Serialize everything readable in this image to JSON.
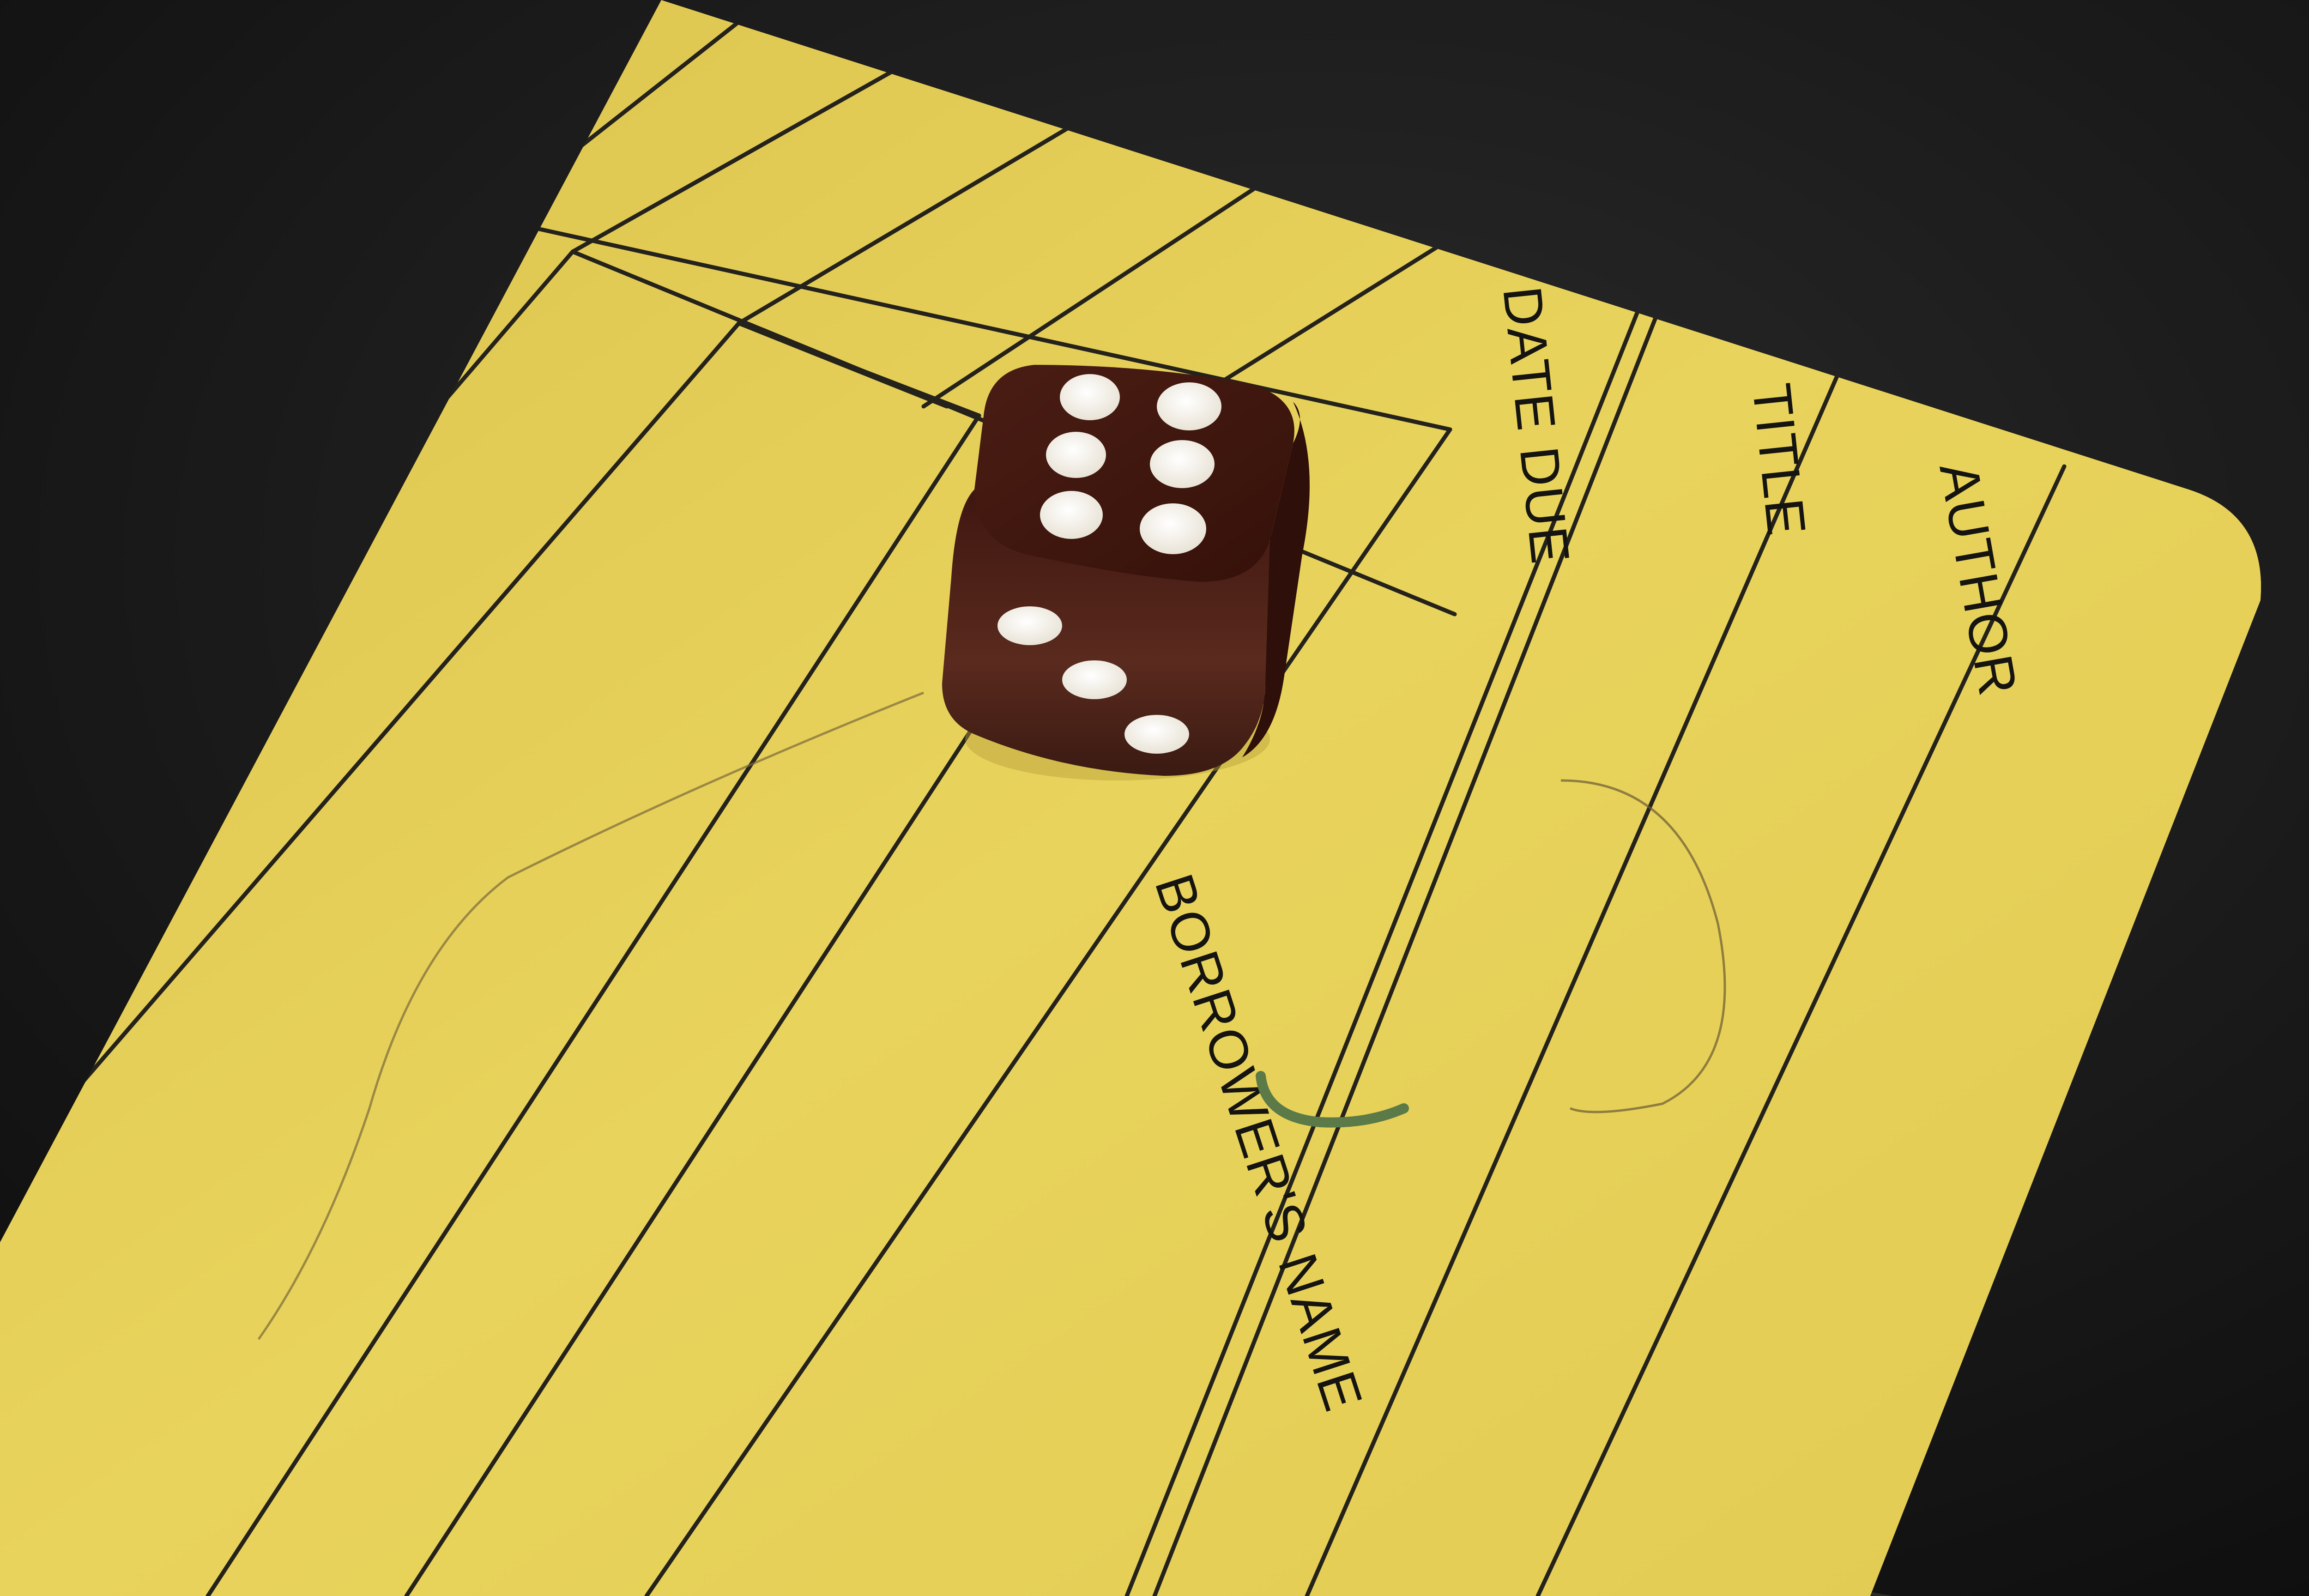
{
  "card": {
    "labels": {
      "author": "AUTHOR",
      "title": "TITLE",
      "date_due": "DATE DUE",
      "borrowers_name": "BORROWER'S NAME"
    }
  },
  "die": {
    "top_face_pips": 6,
    "front_face_pips": 3
  },
  "colors": {
    "background": "#141414",
    "card": "#e6cf55",
    "card_shadow_edge": "#2a2a22",
    "lines": "#24221a",
    "die_body": "#4a1b12",
    "pips": "#f4f1ea"
  }
}
